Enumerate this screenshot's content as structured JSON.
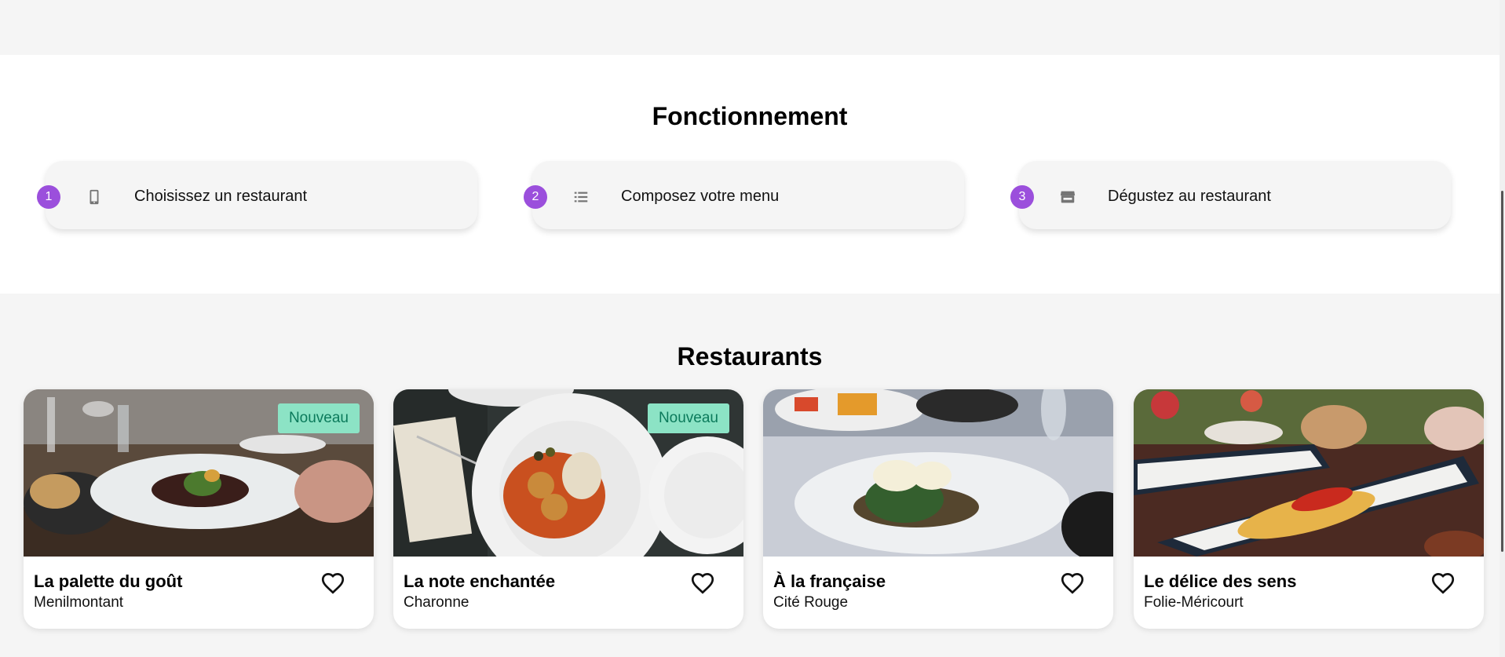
{
  "how": {
    "title": "Fonctionnement",
    "steps": [
      {
        "number": "1",
        "icon": "smartphone-icon",
        "label": "Choisissez un restaurant"
      },
      {
        "number": "2",
        "icon": "list-icon",
        "label": "Composez votre menu"
      },
      {
        "number": "3",
        "icon": "store-icon",
        "label": "Dégustez au restaurant"
      }
    ]
  },
  "restaurants": {
    "title": "Restaurants",
    "items": [
      {
        "name": "La palette du goût",
        "area": "Menilmontant",
        "badge": "Nouveau",
        "photo": "plated-dish-on-restaurant-table",
        "favorite_icon": "heart-outline-icon"
      },
      {
        "name": "La note enchantée",
        "area": "Charonne",
        "badge": "Nouveau",
        "photo": "meatballs-in-tomato-sauce-plate",
        "favorite_icon": "heart-outline-icon"
      },
      {
        "name": "À la française",
        "area": "Cité Rouge",
        "badge": "",
        "photo": "poached-eggs-on-toast-plate",
        "favorite_icon": "heart-outline-icon"
      },
      {
        "name": "Le délice des sens",
        "area": "Folie-Méricourt",
        "badge": "",
        "photo": "fish-on-long-platter",
        "favorite_icon": "heart-outline-icon"
      }
    ]
  },
  "colors": {
    "step_number": "#9b4fdc",
    "badge_bg": "#8ce3c5",
    "badge_text": "#0b7a5b",
    "section_bg": "#f5f5f5"
  }
}
